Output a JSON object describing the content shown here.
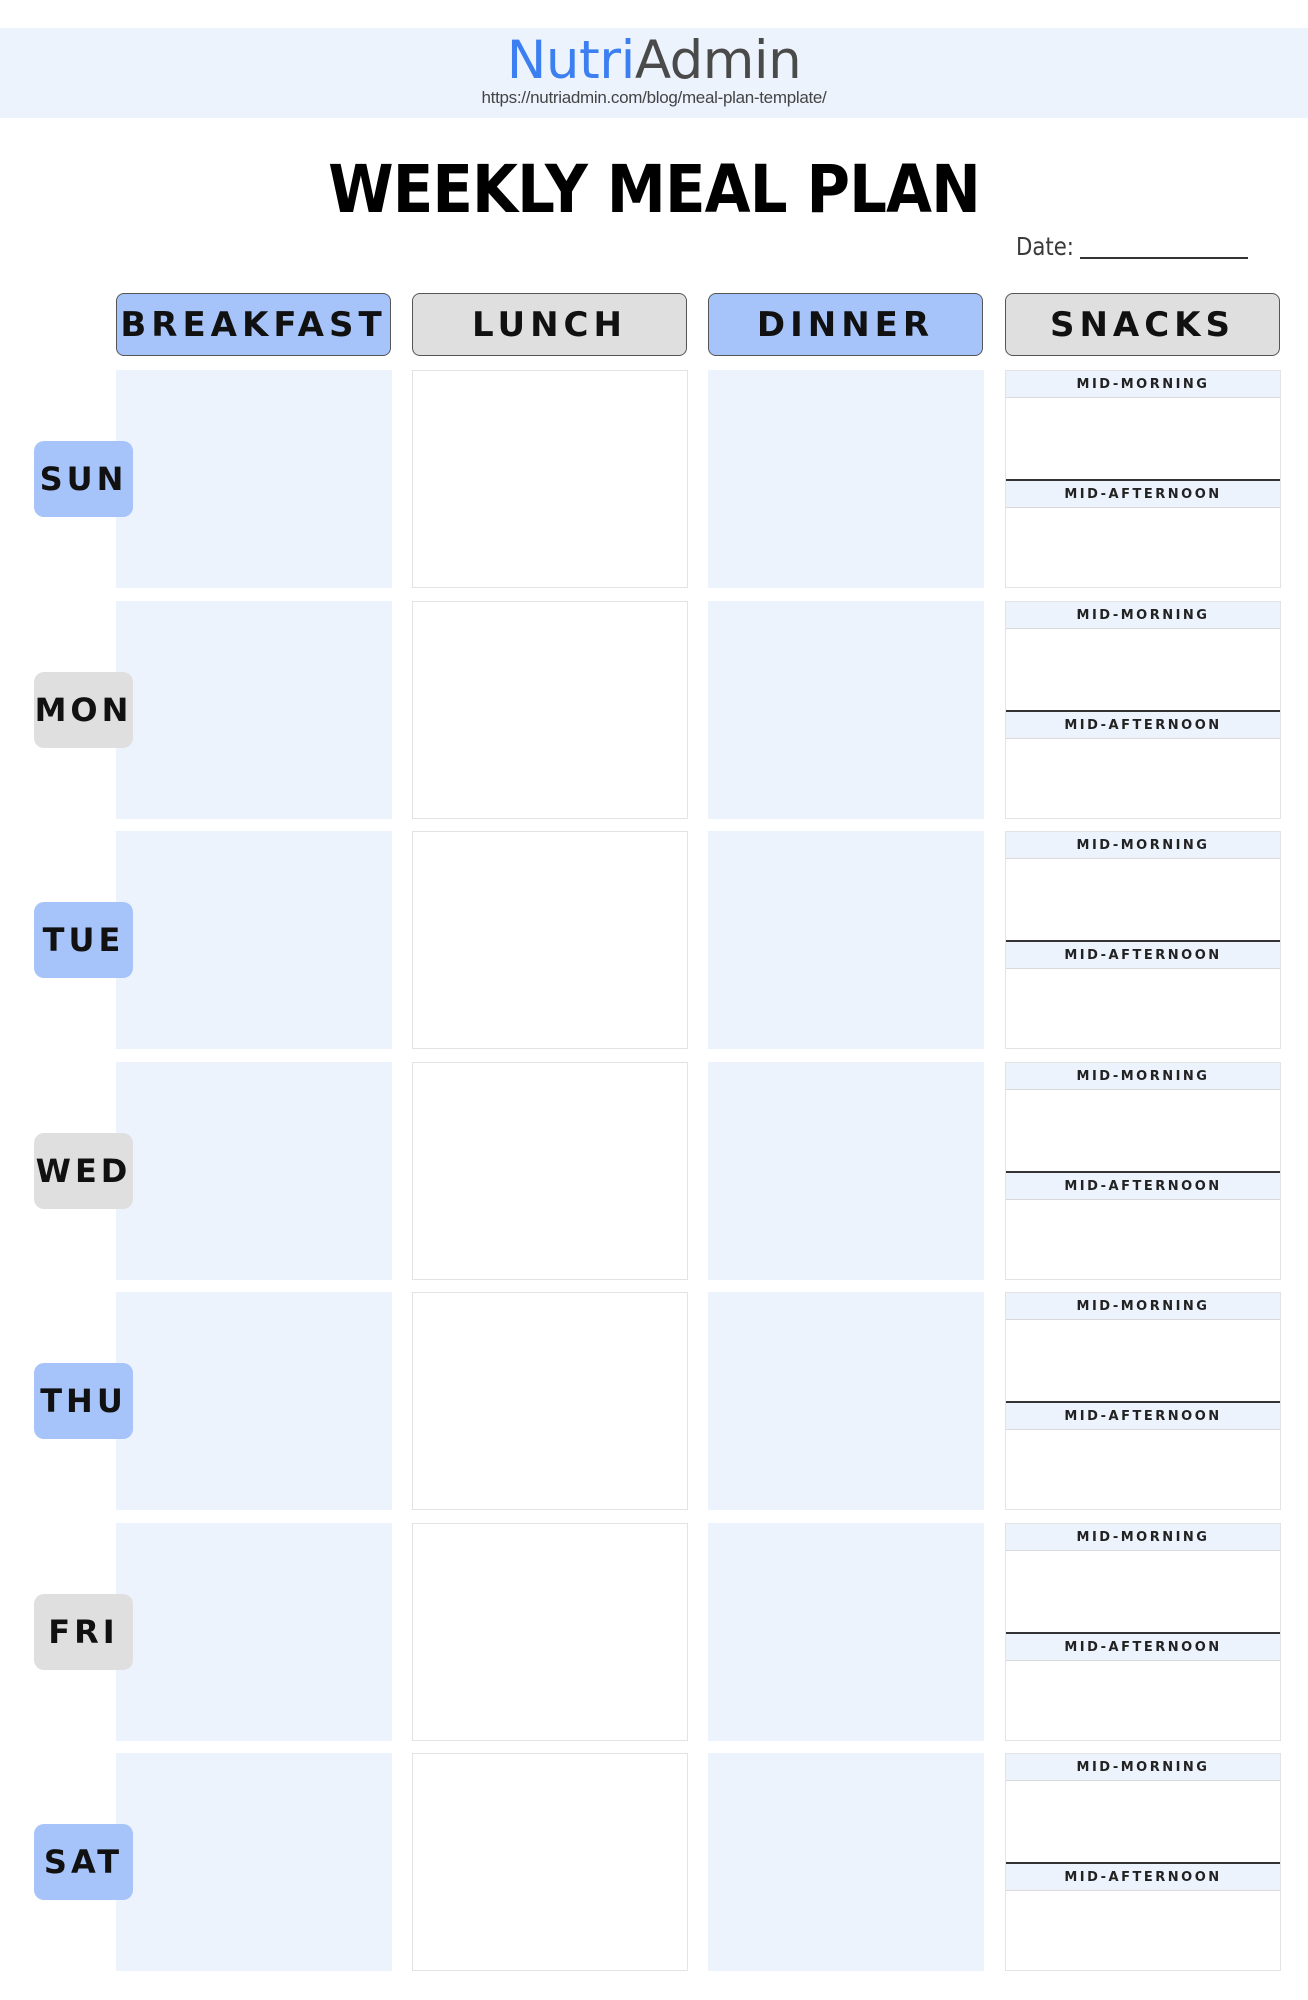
{
  "brand": {
    "part1": "Nutri",
    "part2": "Admin",
    "url": "https://nutriadmin.com/blog/meal-plan-template/"
  },
  "title": "WEEKLY MEAL PLAN",
  "date_label": "Date:",
  "columns": [
    "BREAKFAST",
    "LUNCH",
    "DINNER",
    "SNACKS"
  ],
  "snack_labels": {
    "morning": "MID-MORNING",
    "afternoon": "MID-AFTERNOON"
  },
  "days": [
    "SUN",
    "MON",
    "TUE",
    "WED",
    "THU",
    "FRI",
    "SAT"
  ],
  "colors": {
    "accent_blue": "#a6c4fa",
    "light_blue": "#edf3fd",
    "grey": "#dfdfdf",
    "brand_blue": "#3b7ff0"
  }
}
